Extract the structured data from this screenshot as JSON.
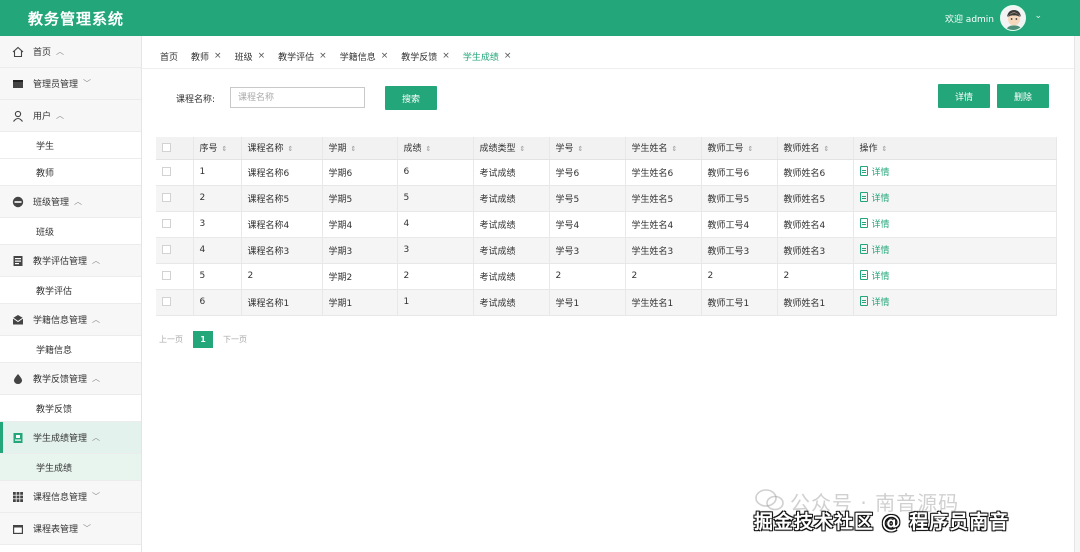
{
  "app": {
    "title": "教务管理系统",
    "welcome": "欢迎 admin"
  },
  "sidebar": {
    "items": [
      {
        "label": "首页",
        "icon": "home-icon",
        "chevron": "^"
      },
      {
        "label": "管理员管理",
        "icon": "admin-icon",
        "chevron": "v"
      },
      {
        "label": "用户",
        "icon": "user-icon",
        "chevron": "^"
      },
      {
        "label": "学生",
        "sub": true
      },
      {
        "label": "教师",
        "sub": true
      },
      {
        "label": "班级管理",
        "icon": "class-icon",
        "chevron": "^"
      },
      {
        "label": "班级",
        "sub": true
      },
      {
        "label": "教学评估管理",
        "icon": "evaluation-icon",
        "chevron": "^"
      },
      {
        "label": "教学评估",
        "sub": true
      },
      {
        "label": "学籍信息管理",
        "icon": "mail-icon",
        "chevron": "^"
      },
      {
        "label": "学籍信息",
        "sub": true
      },
      {
        "label": "教学反馈管理",
        "icon": "feedback-icon",
        "chevron": "^"
      },
      {
        "label": "教学反馈",
        "sub": true
      },
      {
        "label": "学生成绩管理",
        "icon": "grade-icon",
        "chevron": "^",
        "active": true
      },
      {
        "label": "学生成绩",
        "sub": true,
        "active": true
      },
      {
        "label": "课程信息管理",
        "icon": "grid-icon",
        "chevron": "v"
      },
      {
        "label": "课程表管理",
        "icon": "calendar-icon",
        "chevron": "v"
      }
    ]
  },
  "tabs": [
    {
      "label": "首页",
      "closable": false
    },
    {
      "label": "教师",
      "closable": true
    },
    {
      "label": "班级",
      "closable": true
    },
    {
      "label": "教学评估",
      "closable": true
    },
    {
      "label": "学籍信息",
      "closable": true
    },
    {
      "label": "教学反馈",
      "closable": true
    },
    {
      "label": "学生成绩",
      "closable": true,
      "active": true
    }
  ],
  "tab_close_glyph": "×",
  "search": {
    "label": "课程名称:",
    "placeholder": "课程名称",
    "button": "搜索"
  },
  "actions": {
    "detail": "详情",
    "delete": "删除"
  },
  "table": {
    "headers": [
      "序号",
      "课程名称",
      "学期",
      "成绩",
      "成绩类型",
      "学号",
      "学生姓名",
      "教师工号",
      "教师姓名",
      "操作"
    ],
    "sort_glyph": "⇕",
    "detail_label": "详情",
    "rows": [
      [
        "1",
        "课程名称6",
        "学期6",
        "6",
        "考试成绩",
        "学号6",
        "学生姓名6",
        "教师工号6",
        "教师姓名6"
      ],
      [
        "2",
        "课程名称5",
        "学期5",
        "5",
        "考试成绩",
        "学号5",
        "学生姓名5",
        "教师工号5",
        "教师姓名5"
      ],
      [
        "3",
        "课程名称4",
        "学期4",
        "4",
        "考试成绩",
        "学号4",
        "学生姓名4",
        "教师工号4",
        "教师姓名4"
      ],
      [
        "4",
        "课程名称3",
        "学期3",
        "3",
        "考试成绩",
        "学号3",
        "学生姓名3",
        "教师工号3",
        "教师姓名3"
      ],
      [
        "5",
        "2",
        "学期2",
        "2",
        "考试成绩",
        "2",
        "2",
        "2",
        "2"
      ],
      [
        "6",
        "课程名称1",
        "学期1",
        "1",
        "考试成绩",
        "学号1",
        "学生姓名1",
        "教师工号1",
        "教师姓名1"
      ]
    ]
  },
  "pagination": {
    "prev": "上一页",
    "current": "1",
    "next": "下一页"
  },
  "watermark": {
    "line1": "公众号 · 南音源码",
    "line2": "掘金技术社区 @ 程序员南音"
  },
  "colors": {
    "brand": "#22a67a"
  }
}
